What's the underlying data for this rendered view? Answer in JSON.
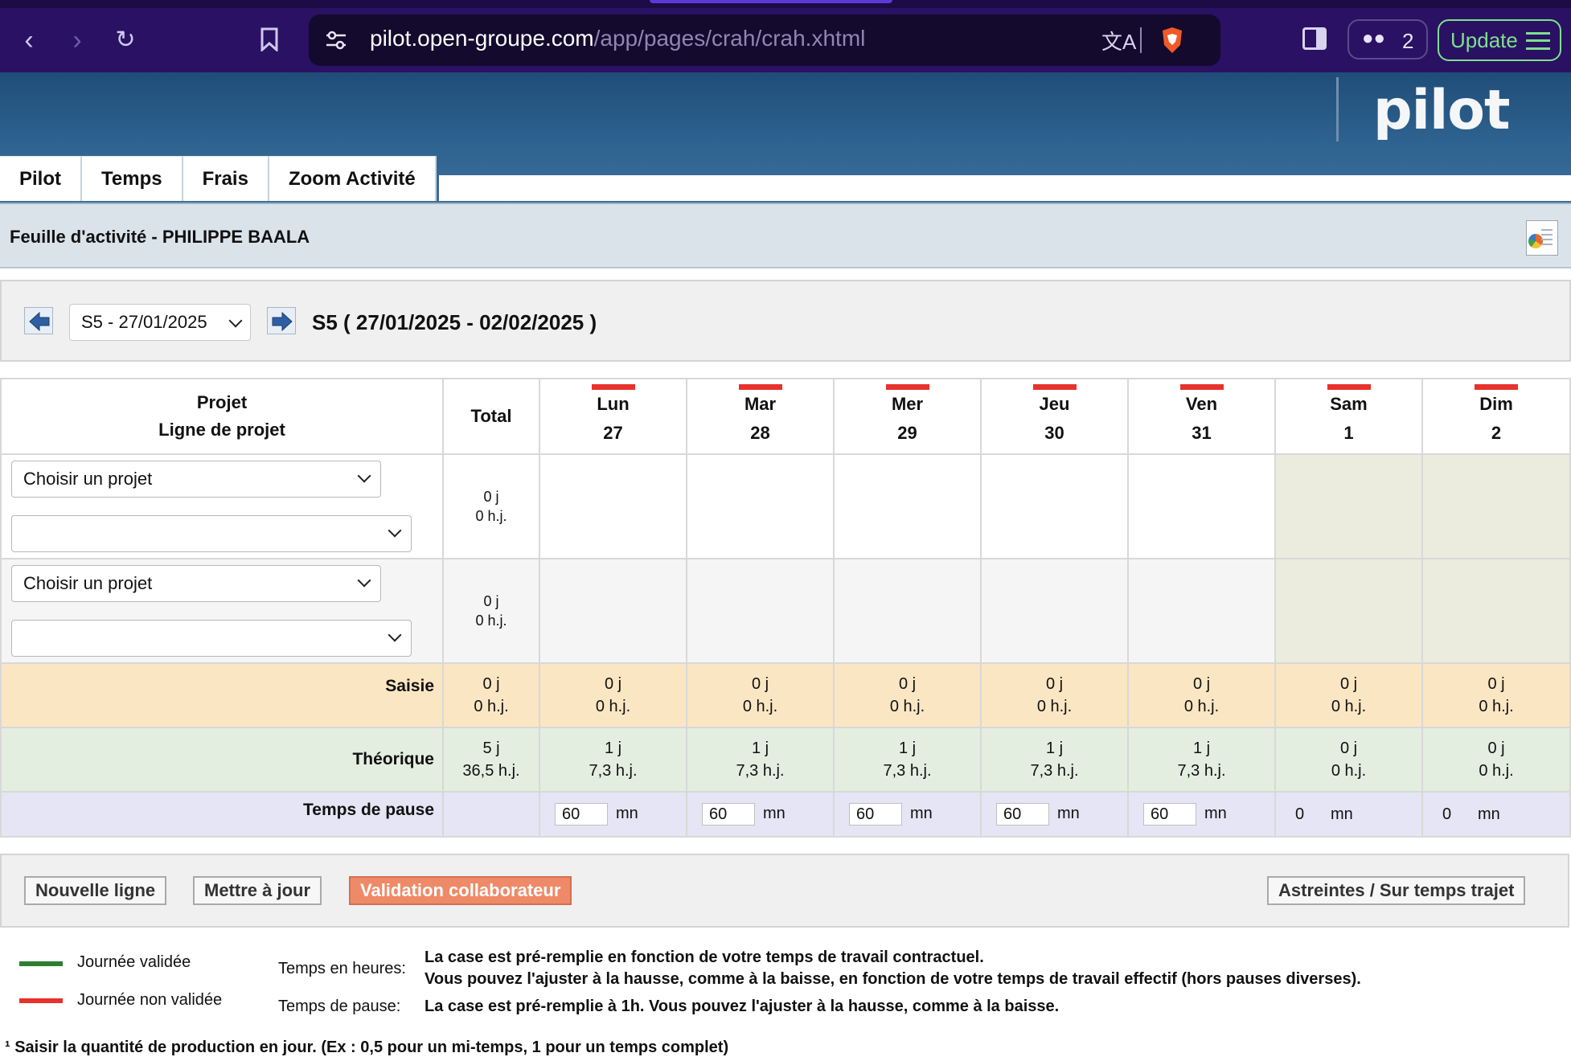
{
  "browser": {
    "url_host": "pilot.open-groupe.com",
    "url_path": "/app/pages/crah/crah.xhtml",
    "vpn_count": "2",
    "update_label": "Update"
  },
  "app": {
    "logo": "pilot",
    "tabs": [
      "Pilot",
      "Temps",
      "Frais",
      "Zoom Activité"
    ],
    "page_title": "Feuille d'activité - PHILIPPE BAALA"
  },
  "week_nav": {
    "selected_week": "S5 - 27/01/2025",
    "week_label": "S5 ( 27/01/2025 - 02/02/2025 )"
  },
  "grid": {
    "project_header_line1": "Projet",
    "project_header_line2": "Ligne de projet",
    "total_header": "Total",
    "days": [
      {
        "name": "Lun",
        "num": "27"
      },
      {
        "name": "Mar",
        "num": "28"
      },
      {
        "name": "Mer",
        "num": "29"
      },
      {
        "name": "Jeu",
        "num": "30"
      },
      {
        "name": "Ven",
        "num": "31"
      },
      {
        "name": "Sam",
        "num": "1"
      },
      {
        "name": "Dim",
        "num": "2"
      }
    ],
    "project_rows": [
      {
        "project_select": "Choisir un projet",
        "line_select": "",
        "total_j": "0 j",
        "total_hj": "0 h.j."
      },
      {
        "project_select": "Choisir un projet",
        "line_select": "",
        "total_j": "0 j",
        "total_hj": "0 h.j."
      }
    ],
    "saisie": {
      "label": "Saisie",
      "total": [
        "0 j",
        "0 h.j."
      ],
      "days": [
        [
          "0 j",
          "0 h.j."
        ],
        [
          "0 j",
          "0 h.j."
        ],
        [
          "0 j",
          "0 h.j."
        ],
        [
          "0 j",
          "0 h.j."
        ],
        [
          "0 j",
          "0 h.j."
        ],
        [
          "0 j",
          "0 h.j."
        ],
        [
          "0 j",
          "0 h.j."
        ]
      ]
    },
    "theorique": {
      "label": "Théorique",
      "total": [
        "5 j",
        "36,5 h.j."
      ],
      "days": [
        [
          "1 j",
          "7,3 h.j."
        ],
        [
          "1 j",
          "7,3 h.j."
        ],
        [
          "1 j",
          "7,3 h.j."
        ],
        [
          "1 j",
          "7,3 h.j."
        ],
        [
          "1 j",
          "7,3 h.j."
        ],
        [
          "0 j",
          "0 h.j."
        ],
        [
          "0 j",
          "0 h.j."
        ]
      ]
    },
    "pause": {
      "label": "Temps de pause",
      "unit": "mn",
      "values": [
        "60",
        "60",
        "60",
        "60",
        "60",
        "0",
        "0"
      ]
    }
  },
  "actions": {
    "new_line": "Nouvelle ligne",
    "update": "Mettre à jour",
    "validate": "Validation collaborateur",
    "oncall": "Astreintes / Sur temps trajet"
  },
  "legend": {
    "validated": "Journée validée",
    "not_validated": "Journée non validée",
    "hours_label": "Temps en heures:",
    "hours_text_1": "La case est pré-remplie en fonction de votre temps de travail contractuel.",
    "hours_text_2": "Vous pouvez l'ajuster à la hausse, comme à la baisse, en fonction de votre temps de travail effectif (hors pauses diverses).",
    "pause_label": "Temps de pause:",
    "pause_text": "La case est pré-remplie à 1h. Vous pouvez l'ajuster à la hausse, comme à la baisse.",
    "footnote": "¹ Saisir la quantité de production en jour. (Ex : 0,5 pour un mi-temps, 1 pour un temps complet)",
    "validated_color": "#2e7d32",
    "not_validated_color": "#e8322c"
  }
}
